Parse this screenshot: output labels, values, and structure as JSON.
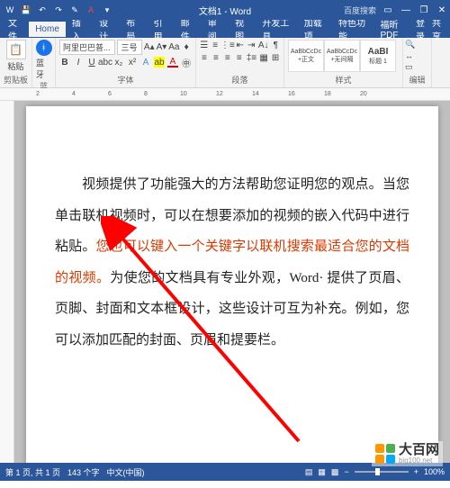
{
  "title_bar": {
    "doc_title": "文档1 - Word",
    "search_placeholder": "百度搜索",
    "qa_save": "💾",
    "qa_undo": "↶",
    "qa_redo": "↷"
  },
  "menu": {
    "items": [
      "文件",
      "Home",
      "插入",
      "设计",
      "布局",
      "引用",
      "邮件",
      "审阅",
      "视图",
      "开发工具",
      "加载项",
      "特色功能",
      "福昕PDF"
    ],
    "active_index": 1,
    "signin": "登录",
    "share": "共享"
  },
  "ribbon": {
    "clipboard": {
      "paste": "粘贴",
      "label": "剪贴板"
    },
    "bluetooth": {
      "label": "蓝牙"
    },
    "font": {
      "name": "阿里巴巴普...",
      "size": "三号",
      "label": "字体"
    },
    "paragraph": {
      "label": "段落"
    },
    "styles": {
      "items": [
        {
          "sample": "AaBbCcDc",
          "name": "+正文"
        },
        {
          "sample": "AaBbCcDc",
          "name": "+无间隔"
        },
        {
          "sample": "AaBI",
          "name": "标题 1"
        }
      ],
      "label": "样式"
    },
    "editing": {
      "label": "编辑"
    }
  },
  "document": {
    "p1_a": "视频提供了功能强大的方法帮助您证明您的观点。当您单击联机视频时，可以在想要添加的视频的嵌入代码中进行粘贴。",
    "p1_hl": "您也可以键入一个关键字以联机搜索最适合您的文档的视频。",
    "p1_b": "为使您的文档具有专业外观，Word· 提供了页眉、页脚、封面和文本框设计，这些设计可互为补充。例如，您可以添加匹配的封面、页眉和提要栏。"
  },
  "status": {
    "page": "第 1 页, 共 1 页",
    "words": "143 个字",
    "lang": "中文(中国)",
    "insert": "",
    "zoom": "100%"
  },
  "watermark": {
    "brand": "大百网",
    "url": "big100.net"
  }
}
